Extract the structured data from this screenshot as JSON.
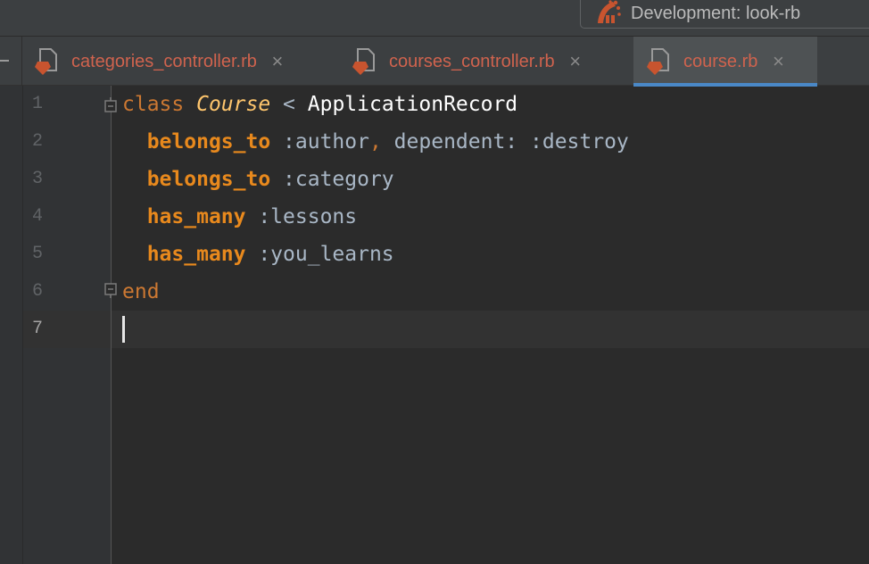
{
  "run_config": {
    "label": "Development: look-rb",
    "icon": "rails-icon"
  },
  "tabs": [
    {
      "label": "categories_controller.rb",
      "icon": "ruby-file-icon",
      "active": false,
      "close": "×"
    },
    {
      "label": "courses_controller.rb",
      "icon": "ruby-file-icon",
      "active": false,
      "close": "×"
    },
    {
      "label": "course.rb",
      "icon": "ruby-file-icon",
      "active": true,
      "close": "×"
    }
  ],
  "editor": {
    "line_numbers": [
      "1",
      "2",
      "3",
      "4",
      "5",
      "6",
      "7"
    ],
    "current_line": "7",
    "lines": [
      {
        "kw": "class",
        "cls": "Course",
        "op": " < ",
        "parent": "ApplicationRecord"
      },
      {
        "indent": "  ",
        "method": "belongs_to",
        "arg": " :author",
        "comma": ",",
        "rest": " dependent: :destroy"
      },
      {
        "indent": "  ",
        "method": "belongs_to",
        "arg": " :category"
      },
      {
        "indent": "  ",
        "method": "has_many",
        "arg": " :lessons"
      },
      {
        "indent": "  ",
        "method": "has_many",
        "arg": " :you_learns"
      },
      {
        "kw": "end"
      }
    ]
  },
  "colors": {
    "keyword": "#cc7832",
    "class_name": "#ffc66d",
    "symbol": "#a9b7c6",
    "tab_label": "#d0634e",
    "active_tab_underline": "#4a88c7",
    "background": "#2b2b2b"
  }
}
